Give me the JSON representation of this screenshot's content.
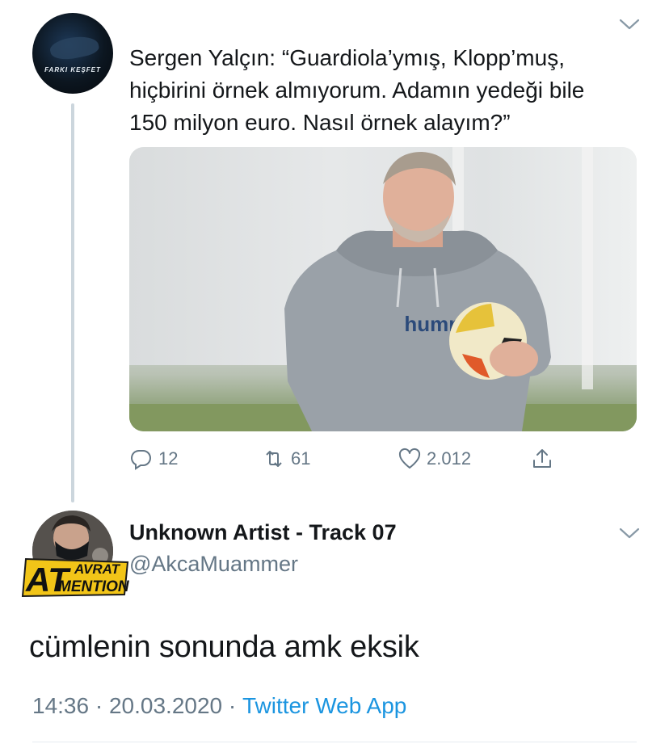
{
  "tweet": {
    "avatar_text": "FARKI KEŞFET",
    "text_lines": [
      "Sergen Yalçın: “Guardiola’ymış, Klopp’muş,",
      "hiçbirini örnek almıyorum. Adamın yedeği bile",
      "150 milyon euro. Nasıl örnek alayım?”"
    ],
    "media": {
      "shirt_brand": "hummel"
    },
    "actions": {
      "reply": {
        "icon": "reply-icon",
        "count": "12"
      },
      "retweet": {
        "icon": "retweet-icon",
        "count": "61"
      },
      "like": {
        "icon": "heart-icon",
        "count": "2.012"
      },
      "share": {
        "icon": "share-icon"
      }
    }
  },
  "reply": {
    "name": "Unknown Artist - Track 07",
    "handle": "@AkcaMuammer",
    "badge": {
      "big": "AT",
      "top": "AVRAT",
      "bottom": "MENTION"
    },
    "text": "cümlenin sonunda amk eksik",
    "time": "14:36",
    "date": "20.03.2020",
    "source": "Twitter Web App",
    "separator": " · "
  },
  "colors": {
    "text": "#14171a",
    "secondary": "#657786",
    "link": "#1b95e0",
    "thread_line": "#ccd6dd"
  }
}
